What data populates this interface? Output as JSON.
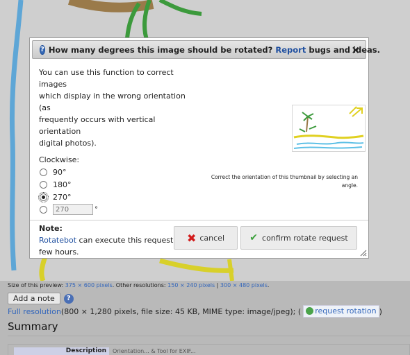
{
  "background": {
    "caption": {
      "prefix": "Size of this preview: ",
      "preview_size": "375 × 600 pixels",
      "other_prefix": ". Other resolutions: ",
      "res1": "150 × 240 pixels",
      "sep": " | ",
      "res2": "300 × 480 pixels",
      "suffix": "."
    },
    "add_note_label": "Add a note",
    "help_icon_glyph": "?",
    "full_resolution": {
      "link": "Full resolution",
      "details": " (800 × 1,280 pixels, file size: 45 KB, MIME type: image/jpeg); (",
      "request_rotation": "request rotation",
      "close_paren": ")"
    },
    "summary_heading": "Summary",
    "description_label": "Description",
    "description_value": "Orientation... & Tool for EXIF..."
  },
  "dialog": {
    "title_prefix": "How many degrees this image should be rotated?",
    "title_link": "Report",
    "title_suffix": "bugs and ideas.",
    "close_glyph": "×",
    "help_icon_glyph": "?",
    "intro": "You can use this function to correct images\nwhich display in the wrong orientation (as\nfrequently occurs with vertical orientation\ndigital photos).",
    "clockwise_label": "Clockwise:",
    "options": [
      {
        "label": "90°",
        "checked": false
      },
      {
        "label": "180°",
        "checked": false
      },
      {
        "label": "270°",
        "checked": true
      }
    ],
    "custom_placeholder": "270",
    "degree_sign": "°",
    "note_label": "Note:",
    "note_link": "Rotatebot",
    "note_text": " can execute this request in a few hours.",
    "thumbnail_caption": "Correct the orientation of this thumbnail by selecting an angle.",
    "cancel_label": "cancel",
    "confirm_label": "confirm rotate request"
  },
  "colors": {
    "link": "#2050a0",
    "cancel_icon": "#d21c1c",
    "confirm_icon": "#3ba03b"
  }
}
